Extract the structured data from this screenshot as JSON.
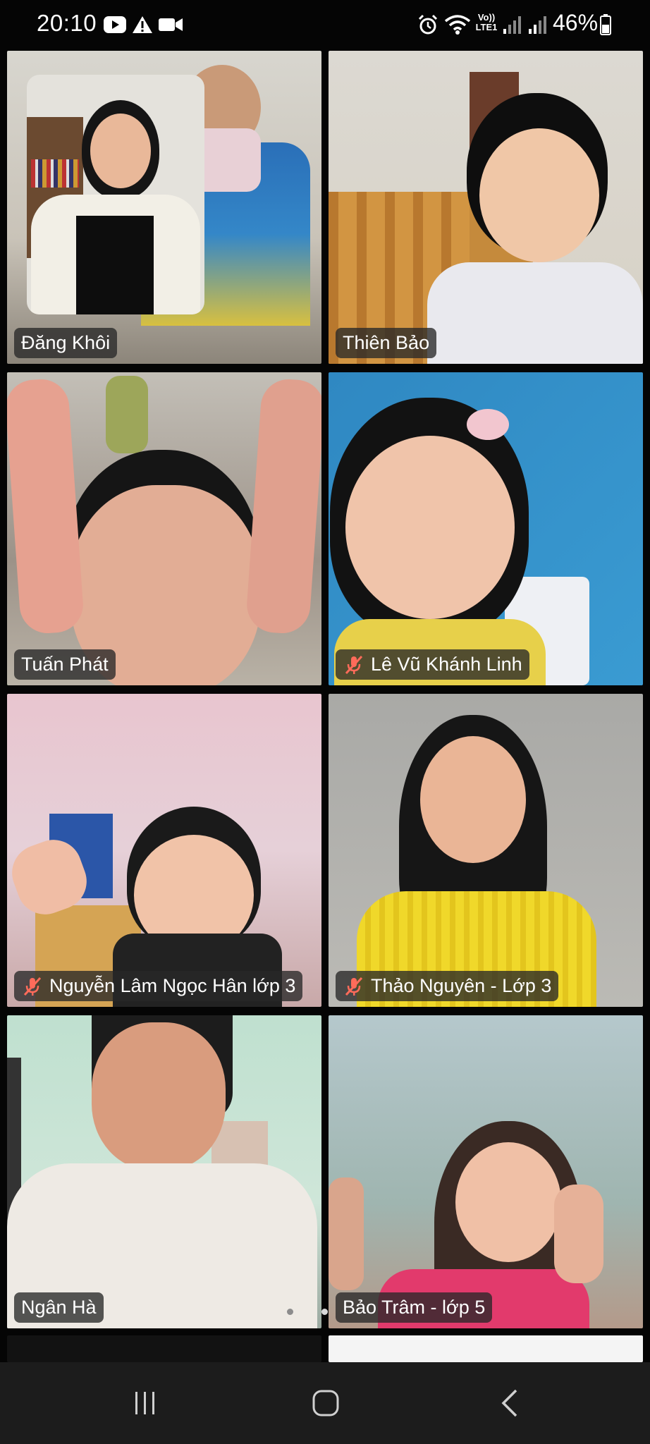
{
  "status_bar": {
    "time": "20:10",
    "network_label": "Vo)) LTE1",
    "battery": "46%",
    "icons": [
      "youtube-icon",
      "alert-icon",
      "video-camera-icon",
      "alarm-icon",
      "wifi-icon",
      "signal-icon",
      "battery-icon"
    ]
  },
  "participants": [
    {
      "name": "Đăng Khôi",
      "muted": false,
      "active_speaker": false
    },
    {
      "name": "Thiên Bảo",
      "muted": false,
      "active_speaker": false
    },
    {
      "name": "Tuấn Phát",
      "muted": false,
      "active_speaker": true
    },
    {
      "name": "Lê Vũ Khánh Linh",
      "muted": true,
      "active_speaker": false
    },
    {
      "name": "Nguyễn Lâm Ngọc Hân lớp 3",
      "muted": true,
      "active_speaker": false
    },
    {
      "name": "Thảo Nguyên - Lớp 3",
      "muted": true,
      "active_speaker": false
    },
    {
      "name": "Ngân Hà",
      "muted": false,
      "active_speaker": false
    },
    {
      "name": "Bảo Trâm - lớp 5",
      "muted": false,
      "active_speaker": false
    }
  ],
  "pagination": {
    "pages": 2,
    "current_page": 2
  },
  "colors": {
    "active_speaker_border": "#2ecc40",
    "label_bg": "#282828",
    "muted_icon": "#ff6b5a"
  },
  "nav_bar": {
    "icons": [
      "recent-apps-icon",
      "home-icon",
      "back-icon"
    ]
  }
}
